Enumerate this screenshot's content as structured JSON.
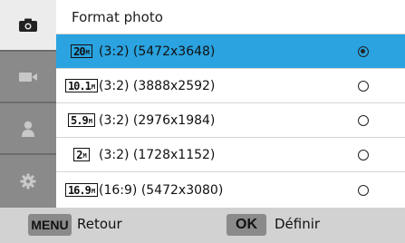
{
  "screen": {
    "title": "Format photo",
    "tabs": [
      {
        "icon": "camera-icon",
        "active": true
      },
      {
        "icon": "video-camera-icon",
        "active": false
      },
      {
        "icon": "person-icon",
        "active": false
      },
      {
        "icon": "gear-icon",
        "active": false
      }
    ],
    "options": [
      {
        "icon_text": "20",
        "icon_suffix": "M",
        "label": "(3:2) (5472x3648)",
        "selected": true
      },
      {
        "icon_text": "10.1",
        "icon_suffix": "M",
        "label": "(3:2) (3888x2592)",
        "selected": false
      },
      {
        "icon_text": "5.9",
        "icon_suffix": "M",
        "label": "(3:2) (2976x1984)",
        "selected": false
      },
      {
        "icon_text": "2",
        "icon_suffix": "M",
        "label": "(3:2) (1728x1152)",
        "selected": false
      },
      {
        "icon_text": "16.9",
        "icon_suffix": "M",
        "label": "(16:9) (5472x3080)",
        "selected": false
      }
    ]
  },
  "footer": {
    "menu_key": "MENU",
    "back_label": "Retour",
    "ok_key": "OK",
    "define_label": "Définir"
  },
  "colors": {
    "selection": "#2aa3e0",
    "sidebar": "#8a8a8a",
    "footer": "#d2d2d2"
  }
}
